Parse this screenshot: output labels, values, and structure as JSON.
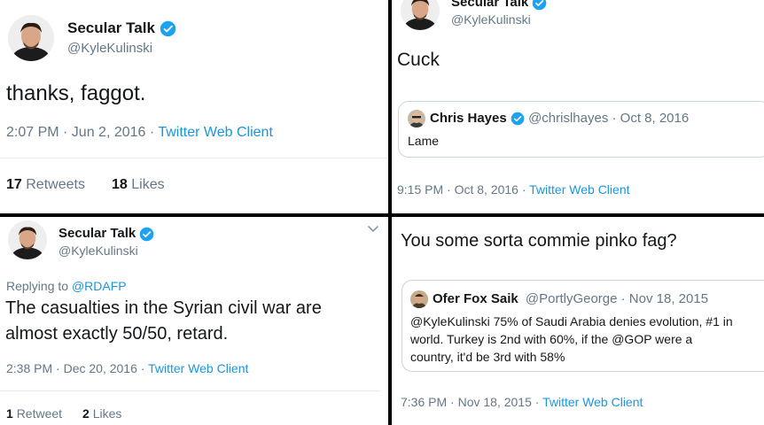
{
  "tweet1": {
    "name": "Secular Talk",
    "handle": "@KyleKulinski",
    "text": "thanks, faggot.",
    "time": "2:07 PM · Jun 2, 2016 · ",
    "client": "Twitter Web Client",
    "retweets_count": "17",
    "retweets_label": "Retweets",
    "likes_count": "18",
    "likes_label": "Likes"
  },
  "tweet2": {
    "name": "Secular Talk",
    "handle": "@KyleKulinski",
    "text": "Cuck",
    "quote": {
      "name": "Chris Hayes",
      "meta": "@chrislhayes · Oct 8, 2016",
      "text": "Lame"
    },
    "time": "9:15 PM · Oct 8, 2016 · ",
    "client": "Twitter Web Client"
  },
  "tweet3": {
    "name": "Secular Talk",
    "handle": "@KyleKulinski",
    "replying_prefix": "Replying to ",
    "replying_to": "@RDAFP",
    "text_line1": "The casualties in the Syrian civil war are",
    "text_line2": "almost exactly 50/50, retard.",
    "time": "2:38 PM · Dec 20, 2016 · ",
    "client": "Twitter Web Client",
    "retweets_count": "1",
    "retweets_label": "Retweet",
    "likes_count": "2",
    "likes_label": "Likes"
  },
  "tweet4": {
    "text": "You some sorta commie pinko fag?",
    "quote": {
      "name": "Ofer Fox Saik",
      "meta": "@PortlyGeorge · Nov 18, 2015",
      "line1": "@KyleKulinski 75% of Saudi Arabia denies evolution, #1 in",
      "line2": "world. Turkey is 2nd with 60%, if the @GOP were a",
      "line3": "country, it'd be 3rd with 58%"
    },
    "time": "7:36 PM · Nov 18, 2015 · ",
    "client": "Twitter Web Client"
  },
  "colors": {
    "link": "#1b95e0",
    "verified": "#1da1f2",
    "muted": "#657786",
    "divider": "#000000"
  },
  "icons": [
    "verified-badge-icon",
    "chevron-down-icon"
  ]
}
